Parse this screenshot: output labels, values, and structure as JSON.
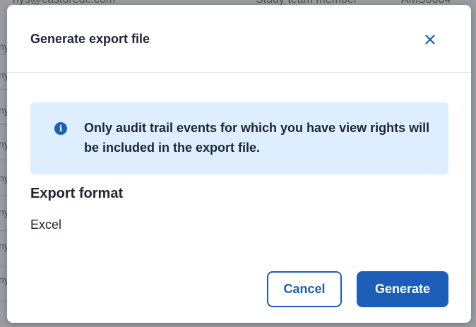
{
  "background": {
    "top_row": {
      "email_fragment": "nys@castoredc.com",
      "role_fragment": "Study team member",
      "code_fragment": "AMS0004"
    },
    "left_fragment": "ny"
  },
  "dialog": {
    "title": "Generate export file",
    "close_icon": "close-icon",
    "info": {
      "icon": "info-icon",
      "icon_glyph": "i",
      "text": "Only audit trail events for which you have view rights will be included in the export file."
    },
    "export_format": {
      "label": "Export format",
      "value": "Excel"
    },
    "buttons": {
      "cancel": "Cancel",
      "generate": "Generate"
    }
  },
  "colors": {
    "accent": "#1c5eb8",
    "info_background": "#ddeeff",
    "text": "#1f2533",
    "overlay": "#9a9da3"
  }
}
